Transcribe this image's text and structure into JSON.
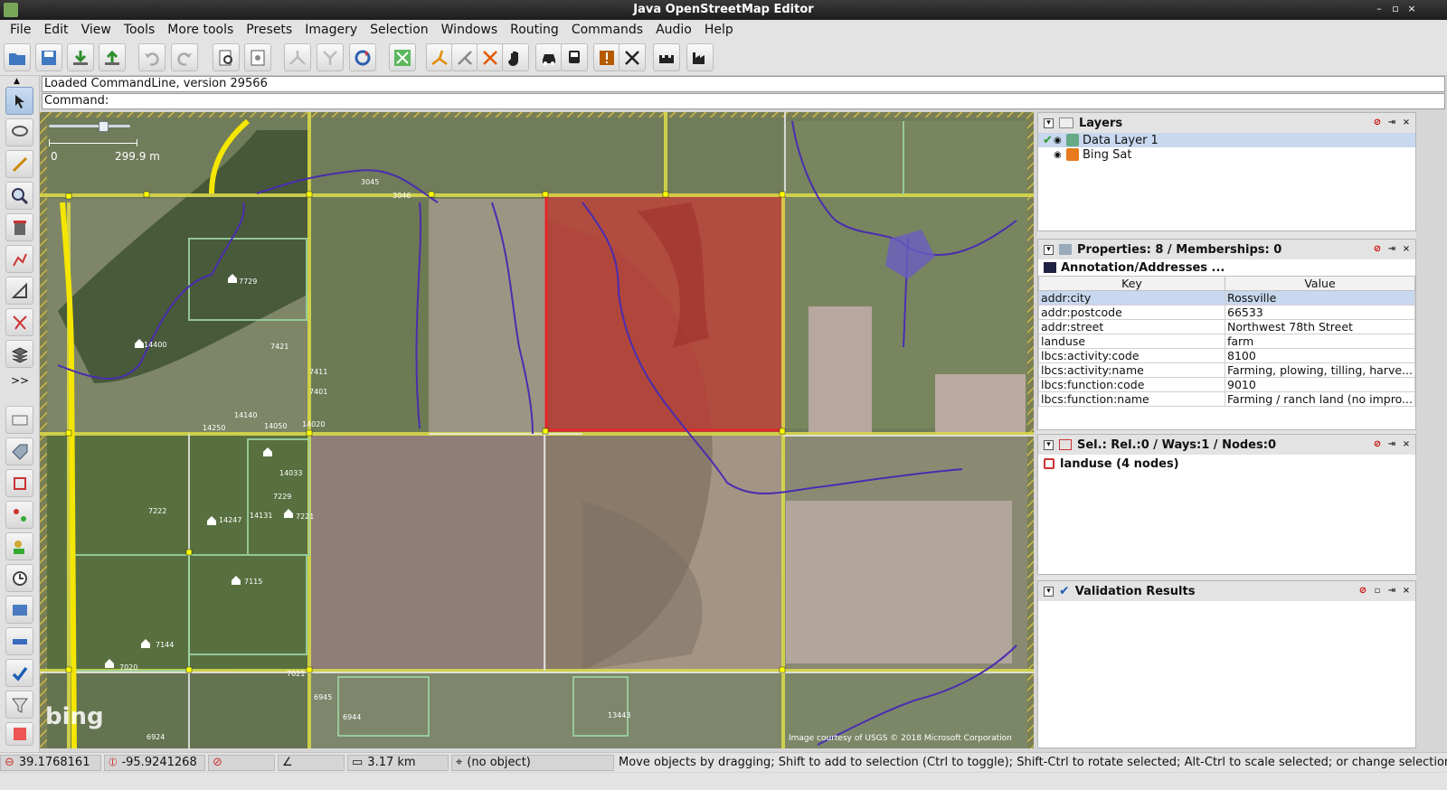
{
  "window": {
    "title": "Java OpenStreetMap Editor"
  },
  "menu": [
    "File",
    "Edit",
    "View",
    "Tools",
    "More tools",
    "Presets",
    "Imagery",
    "Selection",
    "Windows",
    "Routing",
    "Commands",
    "Audio",
    "Help"
  ],
  "command": {
    "line1": "Loaded CommandLine, version 29566",
    "line2": "Command:"
  },
  "map": {
    "scale_zero": "0",
    "scale_value": "299.9 m",
    "attribution": "Image courtesy of USGS © 2018 Microsoft Corporation",
    "bing_logo": "bing",
    "house_numbers": [
      "7729",
      "14400",
      "7421",
      "7411",
      "7401",
      "14250",
      "14140",
      "14050",
      "14020",
      "14033",
      "7229",
      "7222",
      "14247",
      "14131",
      "7221",
      "7115",
      "7144",
      "7020",
      "7021",
      "6945",
      "6944",
      "13443",
      "3045",
      "3046",
      "6924"
    ]
  },
  "layers": {
    "title": "Layers",
    "items": [
      {
        "name": "Data Layer 1",
        "selected": true
      },
      {
        "name": "Bing Sat",
        "selected": false
      }
    ]
  },
  "properties": {
    "title": "Properties: 8 / Memberships: 0",
    "preset": "Annotation/Addresses ...",
    "col_key": "Key",
    "col_value": "Value",
    "rows": [
      {
        "key": "addr:city",
        "value": "Rossville"
      },
      {
        "key": "addr:postcode",
        "value": "66533"
      },
      {
        "key": "addr:street",
        "value": "Northwest 78th Street"
      },
      {
        "key": "landuse",
        "value": "farm"
      },
      {
        "key": "lbcs:activity:code",
        "value": "8100"
      },
      {
        "key": "lbcs:activity:name",
        "value": "Farming, plowing, tilling, harve..."
      },
      {
        "key": "lbcs:function:code",
        "value": "9010"
      },
      {
        "key": "lbcs:function:name",
        "value": "Farming / ranch land (no impro..."
      }
    ]
  },
  "selection": {
    "title": "Sel.: Rel.:0 / Ways:1 / Nodes:0",
    "item": "landuse (4 nodes)"
  },
  "validation": {
    "title": "Validation Results"
  },
  "status": {
    "lat": "39.1768161",
    "lon": "-95.9241268",
    "distance": "3.17 km",
    "object": "(no object)",
    "help": "Move objects by dragging; Shift to add to selection (Ctrl to toggle); Shift-Ctrl to rotate selected; Alt-Ctrl to scale selected; or change selection"
  },
  "colors": {
    "selection": "#e8262a",
    "ways": "#e0e000",
    "route": "#4a2db0",
    "panel_sel": "#c8d8ee"
  }
}
